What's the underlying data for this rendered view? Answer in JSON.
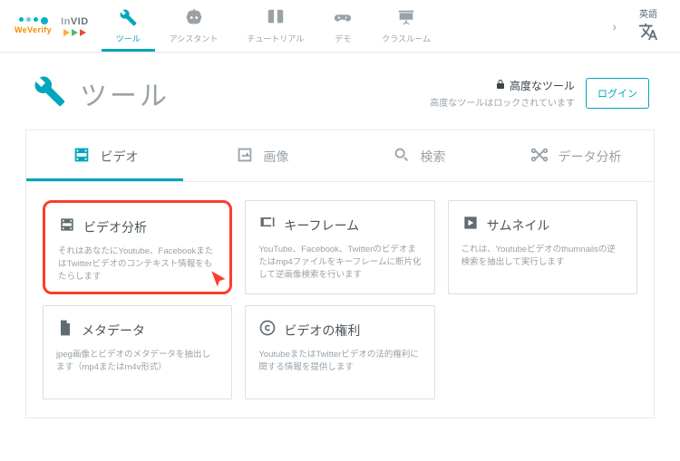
{
  "header": {
    "logo1": "WeVerify",
    "logo2_in": "In",
    "logo2_vid": "VID",
    "nav": {
      "tools": "ツール",
      "assistant": "アシスタント",
      "tutorial": "チュートリアル",
      "demo": "デモ",
      "classroom": "クラスルーム"
    },
    "language_label": "英語"
  },
  "page": {
    "title": "ツール",
    "advanced_title": "高度なツール",
    "advanced_sub": "高度なツールはロックされています",
    "login": "ログイン"
  },
  "tabs": {
    "video": "ビデオ",
    "image": "画像",
    "search": "検索",
    "data": "データ分析"
  },
  "cards": {
    "analysis": {
      "title": "ビデオ分析",
      "desc": "それはあなたにYoutube、FacebookまたはTwitterビデオのコンテキスト情報をもたらします"
    },
    "keyframe": {
      "title": "キーフレーム",
      "desc": "YouTube、Facebook、Twitterのビデオまたはmp4ファイルをキーフレームに断片化して逆画像検索を行います"
    },
    "thumbnail": {
      "title": "サムネイル",
      "desc": "これは、Youtubeビデオのthumnailsの逆検索を抽出して実行します"
    },
    "metadata": {
      "title": "メタデータ",
      "desc": "jpeg画像とビデオのメタデータを抽出します（mp4またはm4v形式）"
    },
    "rights": {
      "title": "ビデオの権利",
      "desc": "YoutubeまたはTwitterビデオの法的権利に関する情報を提供します"
    }
  }
}
